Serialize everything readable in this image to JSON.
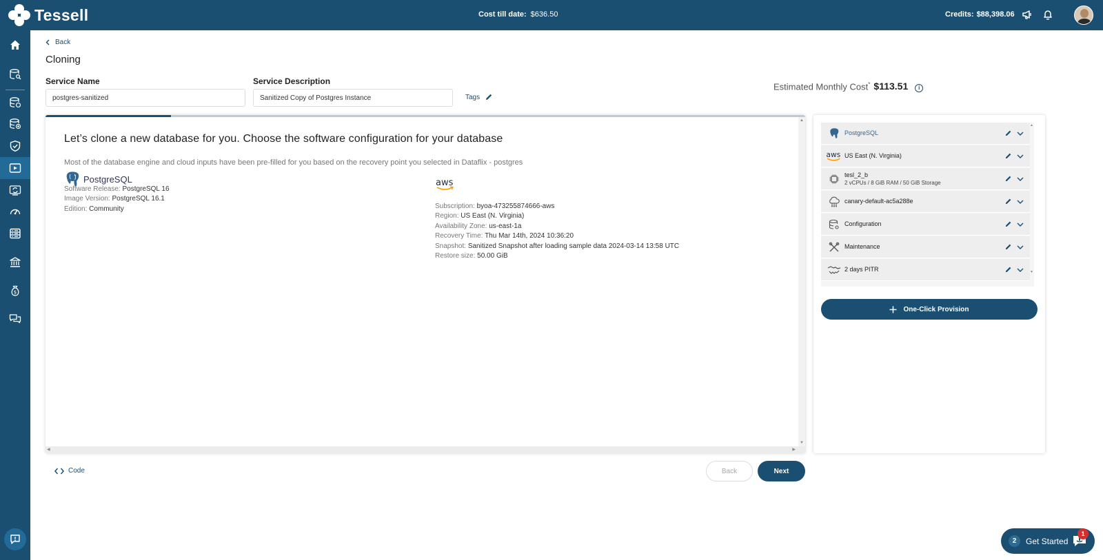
{
  "topbar": {
    "logo_text": "Tessell",
    "cost_label": "Cost till date:",
    "cost_value": "$636.50",
    "credits_label": "Credits:",
    "credits_value": "$88,398.06"
  },
  "sidebar": {
    "items": [
      {
        "icon": "home-icon"
      },
      {
        "icon": "database-search-icon"
      },
      {
        "icon": "database-money-icon"
      },
      {
        "icon": "database-add-icon"
      },
      {
        "icon": "shield-check-icon"
      },
      {
        "icon": "play-screen-icon",
        "active": true
      },
      {
        "icon": "refresh-screen-icon"
      },
      {
        "icon": "speedometer-icon"
      },
      {
        "icon": "server-list-icon"
      },
      {
        "icon": "bank-icon"
      },
      {
        "icon": "money-bag-icon"
      },
      {
        "icon": "chat-icon"
      }
    ],
    "help_icon": "feedback-icon"
  },
  "page": {
    "back_label": "Back",
    "title": "Cloning",
    "service_name_label": "Service Name",
    "service_name_value": "postgres-sanitized",
    "service_description_label": "Service Description",
    "service_description_value": "Sanitized Copy of Postgres Instance",
    "tags_label": "Tags",
    "estimated_cost_label": "Estimated Monthly Cost",
    "estimated_cost_marker": "*",
    "estimated_cost_value": "$113.51",
    "progress_fraction": 0.165
  },
  "card": {
    "heading": "Let’s clone a new database for you. Choose the software configuration for your database",
    "subtext": "Most of the database engine and cloud inputs have been pre-filled for you based on the recovery point you selected in Dataflix - postgres",
    "engine_logo_text": "PostgreSQL",
    "engine_details": [
      {
        "label": "Software Release:",
        "value": "PostgreSQL 16"
      },
      {
        "label": "Image Version:",
        "value": "PostgreSQL 16.1"
      },
      {
        "label": "Edition:",
        "value": "Community"
      }
    ],
    "cloud_logo_text": "aws",
    "cloud_details": [
      {
        "label": "Subscription:",
        "value": "byoa-473255874666-aws"
      },
      {
        "label": "Region:",
        "value": "US East (N. Virginia)"
      },
      {
        "label": "Availability Zone:",
        "value": "us-east-1a"
      },
      {
        "label": "Recovery Time:",
        "value": "Thu Mar 14th, 2024 10:36:20"
      },
      {
        "label": "Snapshot:",
        "value": "Sanitized Snapshot after loading sample data 2024-03-14 13:58 UTC"
      },
      {
        "label": "Restore size:",
        "value": "50.00 GiB"
      }
    ]
  },
  "footer": {
    "code_label": "Code",
    "back_button": "Back",
    "next_button": "Next"
  },
  "summary": {
    "rows": [
      {
        "icon": "postgresql-icon",
        "title": "PostgreSQL",
        "subtitle": ""
      },
      {
        "icon": "aws-icon",
        "title": "US East (N. Virginia)",
        "subtitle": ""
      },
      {
        "icon": "cpu-chip-icon",
        "title": "tesl_2_b",
        "subtitle": "2 vCPUs / 8 GiB RAM / 50 GiB Storage"
      },
      {
        "icon": "cloud-network-icon",
        "title": "canary-default-ac5a288e",
        "subtitle": ""
      },
      {
        "icon": "database-gear-icon",
        "title": "Configuration",
        "subtitle": ""
      },
      {
        "icon": "tools-icon",
        "title": "Maintenance",
        "subtitle": ""
      },
      {
        "icon": "handshake-icon",
        "title": "2 days PITR",
        "subtitle": ""
      }
    ],
    "provision_button": "One-Click Provision"
  },
  "get_started": {
    "count": "2",
    "label": "Get Started",
    "badge": "1"
  },
  "colors": {
    "primary": "#1b4f72",
    "sidebar_active": "#226a98",
    "badge_red": "#d32f2f"
  }
}
